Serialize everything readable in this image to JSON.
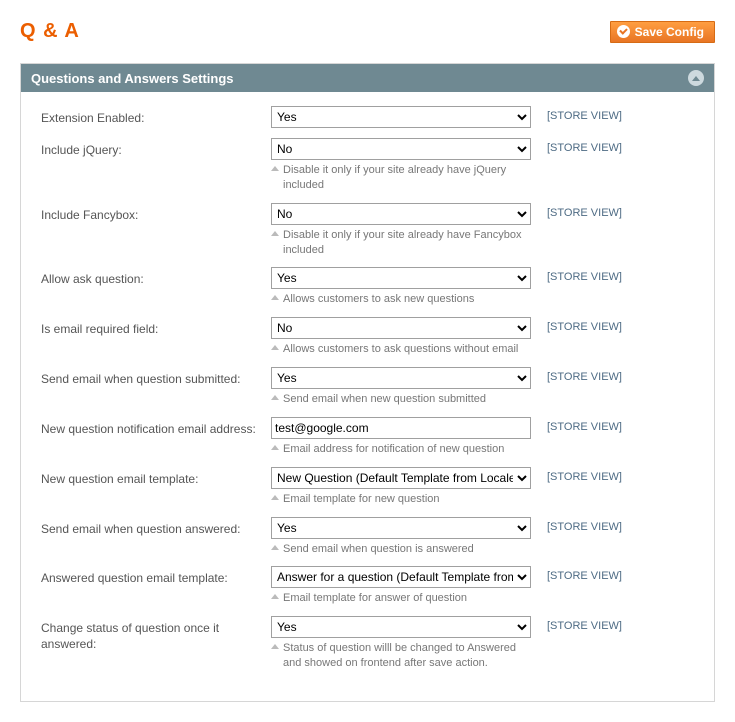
{
  "page_title": "Q & A",
  "save_label": "Save Config",
  "panel_title": "Questions and Answers Settings",
  "scope_label": "[STORE VIEW]",
  "fields": {
    "enabled": {
      "label": "Extension Enabled:",
      "value": "Yes",
      "hint": ""
    },
    "jquery": {
      "label": "Include jQuery:",
      "value": "No",
      "hint": "Disable it only if your site already have jQuery included"
    },
    "fancybox": {
      "label": "Include Fancybox:",
      "value": "No",
      "hint": "Disable it only if your site already have Fancybox included"
    },
    "allow_ask": {
      "label": "Allow ask question:",
      "value": "Yes",
      "hint": "Allows customers to ask new questions"
    },
    "email_req": {
      "label": "Is email required field:",
      "value": "No",
      "hint": "Allows customers to ask questions without email"
    },
    "send_submit": {
      "label": "Send email when question submitted:",
      "value": "Yes",
      "hint": "Send email when new question submitted"
    },
    "notify_addr": {
      "label": "New question notification email address:",
      "value": "test@google.com",
      "hint": "Email address for notification of new question"
    },
    "new_tpl": {
      "label": "New question email template:",
      "value": "New Question (Default Template from Locale)",
      "hint": "Email template for new question"
    },
    "send_answered": {
      "label": "Send email when question answered:",
      "value": "Yes",
      "hint": "Send email when question is answered"
    },
    "ans_tpl": {
      "label": "Answered question email template:",
      "value": "Answer for a question (Default Template from Locale)",
      "hint": "Email template for answer of question"
    },
    "change_status": {
      "label": "Change status of question once it answered:",
      "value": "Yes",
      "hint": "Status of question willl be changed to Answered and showed on frontend after save action."
    }
  }
}
